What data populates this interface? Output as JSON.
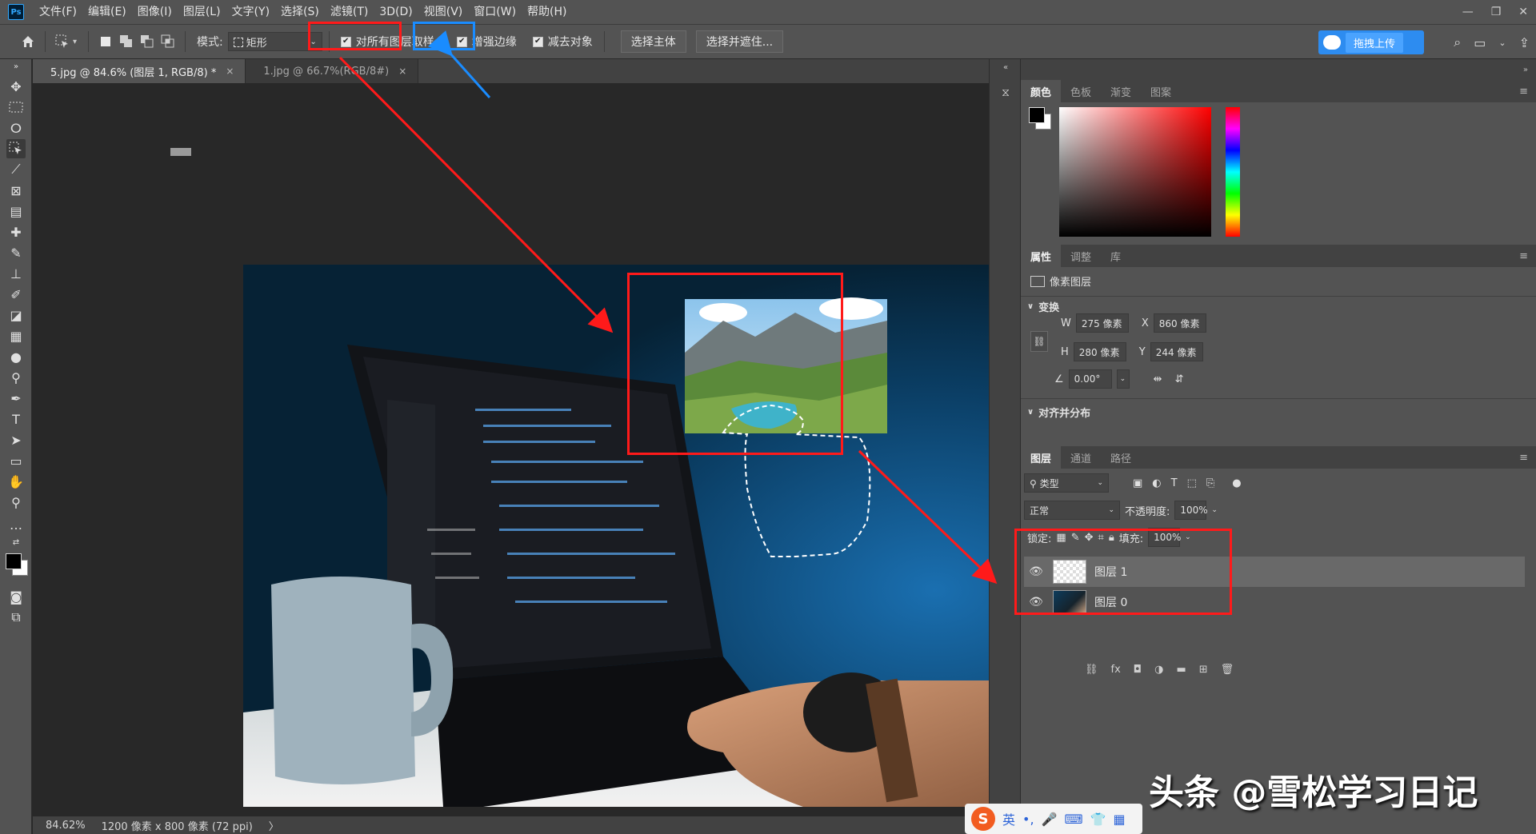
{
  "app": {
    "logo": "Ps"
  },
  "menu": [
    "文件(F)",
    "编辑(E)",
    "图像(I)",
    "图层(L)",
    "文字(Y)",
    "选择(S)",
    "滤镜(T)",
    "3D(D)",
    "视图(V)",
    "窗口(W)",
    "帮助(H)"
  ],
  "window_controls": {
    "minimize": "—",
    "restore": "❐",
    "close": "✕"
  },
  "options": {
    "mode_label": "模式:",
    "mode_value": "矩形",
    "sample_all_layers": "对所有图层取样",
    "enhance_edge": "增强边缘",
    "subtract_object": "减去对象",
    "select_subject": "选择主体",
    "select_and_mask": "选择并遮住...",
    "upload_label": "拖拽上传"
  },
  "tabs": [
    {
      "label": "5.jpg @ 84.6% (图层 1, RGB/8) *",
      "close": "×"
    },
    {
      "label": "1.jpg @ 66.7%(RGB/8#)",
      "close": "×"
    }
  ],
  "status": {
    "zoom": "84.62%",
    "doc_info": "1200 像素 x 800 像素 (72 ppi)",
    "arrow": "〉"
  },
  "color_panel": {
    "tabs": [
      "颜色",
      "色板",
      "渐变",
      "图案"
    ]
  },
  "properties_panel": {
    "tabs": [
      "属性",
      "调整",
      "库"
    ],
    "type": "像素图层",
    "transform_title": "变换",
    "w_label": "W",
    "w_value": "275 像素",
    "x_label": "X",
    "x_value": "860 像素",
    "h_label": "H",
    "h_value": "280 像素",
    "y_label": "Y",
    "y_value": "244 像素",
    "angle_value": "0.00°",
    "align_title": "对齐并分布"
  },
  "layers_panel": {
    "tabs": [
      "图层",
      "通道",
      "路径"
    ],
    "filter_kind": "类型",
    "blend_mode": "正常",
    "opacity_label": "不透明度:",
    "opacity_value": "100%",
    "lock_label": "锁定:",
    "fill_label": "填充:",
    "fill_value": "100%",
    "layers": [
      {
        "name": "图层 1",
        "selected": true
      },
      {
        "name": "图层 0",
        "selected": false
      }
    ]
  },
  "ime": {
    "logo": "S",
    "lang": "英",
    "punct": "•,",
    "mic": "🎤",
    "keyboard": "⌨",
    "shirt": "👕",
    "grid": "▦"
  },
  "watermark": "头条 @雪松学习日记",
  "colors": {
    "annotation_red": "#ff1a1a",
    "annotation_blue": "#1a8cff",
    "upload_blue": "#2d8cf0"
  }
}
